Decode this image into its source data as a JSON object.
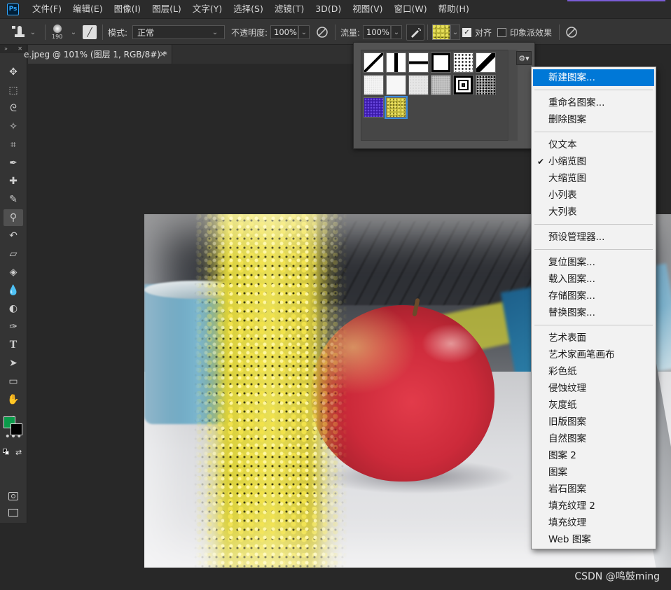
{
  "app": {
    "logo": "Ps"
  },
  "menubar": {
    "items": [
      "文件(F)",
      "编辑(E)",
      "图像(I)",
      "图层(L)",
      "文字(Y)",
      "选择(S)",
      "滤镜(T)",
      "3D(D)",
      "视图(V)",
      "窗口(W)",
      "帮助(H)"
    ]
  },
  "options": {
    "brush_size": "190",
    "mode_label": "模式:",
    "mode_value": "正常",
    "opacity_label": "不透明度:",
    "opacity_value": "100%",
    "flow_label": "流量:",
    "flow_value": "100%",
    "aligned_label": "对齐",
    "aligned_checked": true,
    "impressionist_label": "印象派效果",
    "impressionist_checked": false
  },
  "document": {
    "tab_title": "e.jpeg @ 101% (图层 1, RGB/8#) *",
    "close_glyph": "×"
  },
  "pattern_picker": {
    "gear_glyph": "⚙▾",
    "patterns": [
      "diagonal-line",
      "vertical-bar",
      "horizontal-bar",
      "black-frame",
      "dots",
      "diagonal-stripe",
      "white-noise",
      "white-light",
      "light-gray",
      "gray-noise",
      "concentric-square",
      "black-white-noise",
      "purple-texture",
      "yellow-flowers"
    ],
    "selected_index": 13
  },
  "context_menu": {
    "groups": [
      [
        {
          "label": "新建图案...",
          "highlighted": true
        }
      ],
      [
        {
          "label": "重命名图案..."
        },
        {
          "label": "删除图案"
        }
      ],
      [
        {
          "label": "仅文本"
        },
        {
          "label": "小缩览图",
          "checked": true
        },
        {
          "label": "大缩览图"
        },
        {
          "label": "小列表"
        },
        {
          "label": "大列表"
        }
      ],
      [
        {
          "label": "预设管理器..."
        }
      ],
      [
        {
          "label": "复位图案..."
        },
        {
          "label": "载入图案..."
        },
        {
          "label": "存储图案..."
        },
        {
          "label": "替换图案..."
        }
      ],
      [
        {
          "label": "艺术表面"
        },
        {
          "label": "艺术家画笔画布"
        },
        {
          "label": "彩色纸"
        },
        {
          "label": "侵蚀纹理"
        },
        {
          "label": "灰度纸"
        },
        {
          "label": "旧版图案"
        },
        {
          "label": "自然图案"
        },
        {
          "label": "图案 2"
        },
        {
          "label": "图案"
        },
        {
          "label": "岩石图案"
        },
        {
          "label": "填充纹理 2"
        },
        {
          "label": "填充纹理"
        },
        {
          "label": "Web 图案"
        }
      ]
    ]
  },
  "tools": [
    "move-tool",
    "marquee-tool",
    "lasso-tool",
    "magic-wand-tool",
    "crop-tool",
    "eyedropper-tool",
    "healing-tool",
    "brush-tool",
    "pattern-stamp-tool",
    "history-brush-tool",
    "eraser-tool",
    "paint-bucket-tool",
    "blur-tool",
    "dodge-tool",
    "pen-tool",
    "type-tool",
    "path-selection-tool",
    "rectangle-tool",
    "hand-tool",
    "zoom-tool",
    "more-tools"
  ],
  "active_tool": "pattern-stamp-tool",
  "colors": {
    "foreground": "#0b9a4a",
    "background": "#000000",
    "highlight": "#0078d7"
  },
  "watermark": "CSDN @鸣鼓ming"
}
